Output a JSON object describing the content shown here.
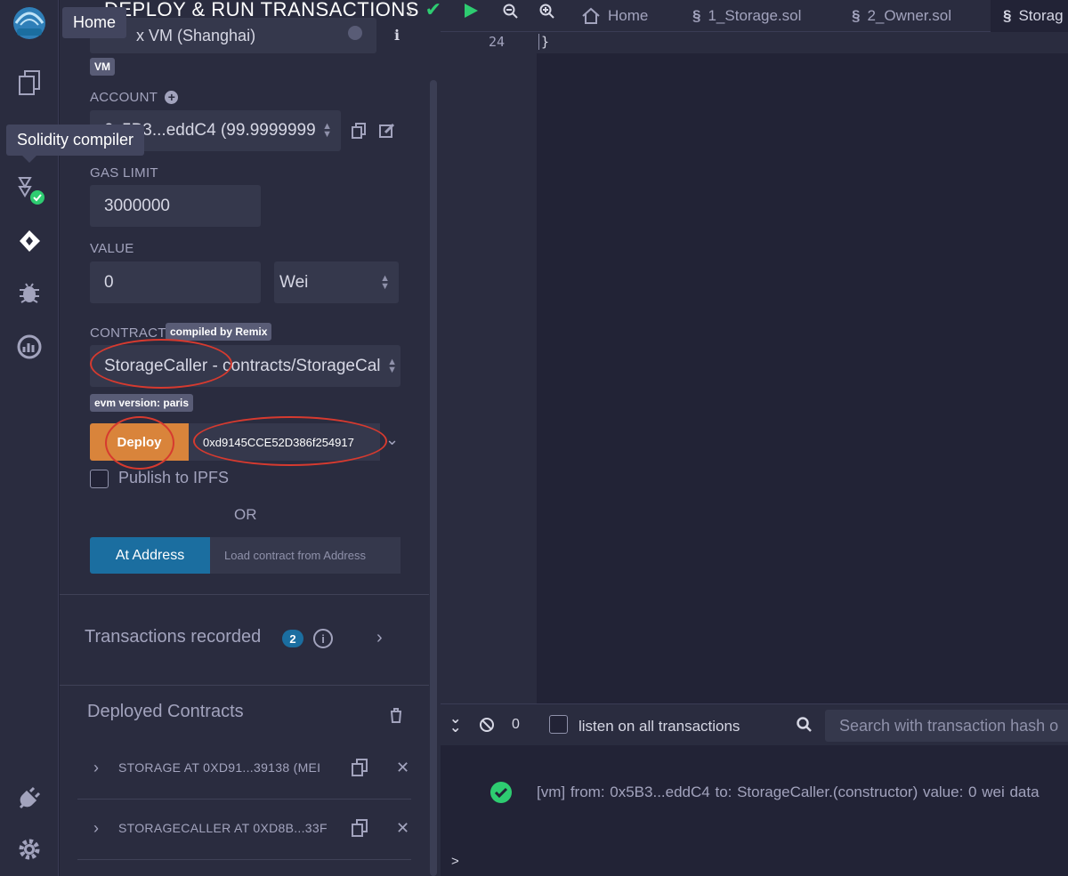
{
  "iconbar": {
    "items": [
      "home-logo",
      "file-explorer",
      "solidity-compiler",
      "deploy-run",
      "debugger",
      "analysis",
      "plugin-manager",
      "settings"
    ]
  },
  "tooltips": {
    "home": "Home",
    "solidity": "Solidity compiler"
  },
  "panel": {
    "title": "DEPLOY & RUN TRANSACTIONS",
    "environment_partial": "x VM (Shanghai)",
    "vm_badge": "VM",
    "account_label": "ACCOUNT",
    "account_value": "0x5B3...eddC4 (99.9999999",
    "gas_label": "GAS LIMIT",
    "gas_value": "3000000",
    "value_label": "VALUE",
    "value_amount": "0",
    "value_unit": "Wei",
    "contract_label": "CONTRACT",
    "compiled_badge": "compiled by Remix",
    "contract_value": "StorageCaller - contracts/StorageCal",
    "evm_badge": "evm version: paris",
    "deploy_label": "Deploy",
    "deploy_arg": "0xd9145CCE52D386f254917",
    "publish_ipfs": "Publish to IPFS",
    "or": "OR",
    "at_address_label": "At Address",
    "load_placeholder": "Load contract from Address",
    "tx_recorded": "Transactions recorded",
    "tx_count": "2",
    "deployed_title": "Deployed Contracts",
    "deployed": [
      {
        "label": "STORAGE AT 0XD91...39138 (MEI"
      },
      {
        "label": "STORAGECALLER AT 0XD8B...33F"
      }
    ]
  },
  "tabs": [
    {
      "label": "Home"
    },
    {
      "label": "1_Storage.sol"
    },
    {
      "label": "2_Owner.sol"
    },
    {
      "label": "Storag"
    }
  ],
  "editor": {
    "line_number": "24",
    "code": "}"
  },
  "terminal": {
    "count": "0",
    "listen_label": "listen on all transactions",
    "search_placeholder": "Search with transaction hash o",
    "log": "[vm]  from: 0x5B3...eddC4  to: StorageCaller.(constructor)  value: 0 wei  data",
    "prompt": ">"
  },
  "colors": {
    "accent_orange": "#d9843b",
    "accent_blue": "#1b6ea0",
    "success": "#2ecc71",
    "annotation": "#d63a2f"
  }
}
